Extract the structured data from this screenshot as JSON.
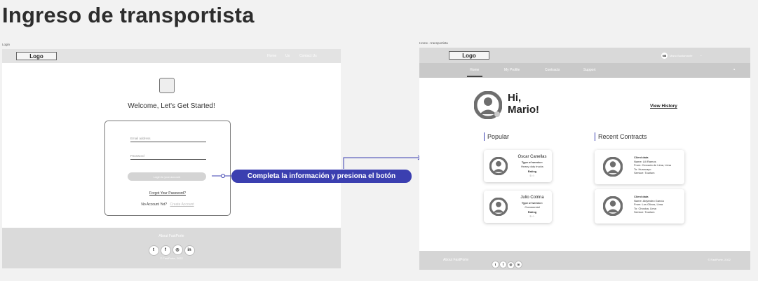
{
  "page_title": "Ingreso de transportista",
  "login": {
    "frame_label": "Login",
    "logo": "Logo",
    "nav": [
      "Home",
      "Us",
      "Contact Us"
    ],
    "welcome": "Welcome, Let's Get Started!",
    "email_placeholder": "Email address",
    "password_placeholder": "Password",
    "login_button": "Login to your account",
    "forgot": "Forgot Your Password?",
    "no_account": "No Account Yet?",
    "create_account": "Create Account",
    "footer_about": "About FastPorte",
    "footer_copy": "© FastPorte, 2022",
    "socials": [
      "twitter-icon",
      "facebook-icon",
      "instagram-icon",
      "linkedin-icon"
    ]
  },
  "callout": {
    "text": "Completa  la información y presiona el botón",
    "color": "#3b3fb0"
  },
  "home": {
    "frame_label": "Home - transportista",
    "logo": "Logo",
    "user_initials": "MB",
    "user_name": "Mario Bustamante",
    "tabs": [
      "Home",
      "My Profile",
      "Contracts",
      "Support"
    ],
    "greeting_line1": "Hi,",
    "greeting_line2": "Mario!",
    "view_history": "View History",
    "popular_title": "Popular",
    "recent_title": "Recent Contracts",
    "popular": [
      {
        "name": "Oscar Canellas",
        "type_label": "Type of service:",
        "type_value": "Heavy duty trucks",
        "rating_label": "Rating",
        "rating": "5 ☆"
      },
      {
        "name": "Julio Cotrina",
        "type_label": "Type of service:",
        "type_value": "Commercial",
        "rating_label": "Rating",
        "rating": "5 ☆"
      }
    ],
    "recent": [
      {
        "title": "Client data",
        "name": "Name: Lili Ramos",
        "from": "From: Cercado de Lima, Lima",
        "to": "To: Huancayo",
        "service": "Service: Tourism"
      },
      {
        "title": "Client data",
        "name": "Name: Alejandro García",
        "from": "From: Los Olivos, Lima",
        "to": "To: Chosica, Lima",
        "service": "Service: Tourism"
      }
    ],
    "footer_about": "About FastPorte",
    "footer_copy": "© FastPorte, 2022",
    "socials": [
      "twitter-icon",
      "facebook-icon",
      "instagram-icon",
      "linkedin-icon"
    ]
  }
}
